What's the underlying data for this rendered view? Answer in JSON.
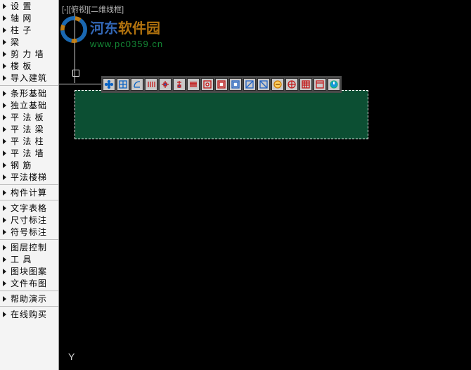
{
  "viewport_label": "[-][俯视][二维线框]",
  "watermark": {
    "title_a": "河东",
    "title_b": "软件园",
    "url": "www.pc0359.cn"
  },
  "sidebar": {
    "groups": [
      [
        {
          "label": "设    置"
        },
        {
          "label": "轴    网"
        },
        {
          "label": "柱    子"
        },
        {
          "label": "梁"
        },
        {
          "label": "剪 力 墙"
        },
        {
          "label": "楼    板"
        },
        {
          "label": "导入建筑"
        }
      ],
      [
        {
          "label": "条形基础"
        },
        {
          "label": "独立基础"
        },
        {
          "label": "平 法 板"
        },
        {
          "label": "平 法 梁"
        },
        {
          "label": "平 法 柱"
        },
        {
          "label": "平 法 墙"
        },
        {
          "label": "钢    筋"
        },
        {
          "label": "平法楼梯"
        }
      ],
      [
        {
          "label": "构件计算"
        }
      ],
      [
        {
          "label": "文字表格"
        },
        {
          "label": "尺寸标注"
        },
        {
          "label": "符号标注"
        }
      ],
      [
        {
          "label": "图层控制"
        },
        {
          "label": "工    具"
        },
        {
          "label": "图块图案"
        },
        {
          "label": "文件布图"
        }
      ],
      [
        {
          "label": "帮助演示"
        }
      ],
      [
        {
          "label": "在线购买"
        }
      ]
    ]
  },
  "toolbar": {
    "buttons": [
      {
        "name": "flower-icon",
        "stroke": "#0963c4",
        "fill": "#0963c4"
      },
      {
        "name": "grid-icon",
        "stroke": "#0963c4",
        "fill": "#e0e0e0"
      },
      {
        "name": "profile-icon",
        "stroke": "#0963c4",
        "fill": "#e0e0e0"
      },
      {
        "name": "columns-icon",
        "stroke": "#c41818",
        "fill": "#e0e0e0"
      },
      {
        "name": "cross-icon",
        "stroke": "#c41818",
        "fill": "#2163c4"
      },
      {
        "name": "marker-icon",
        "stroke": "#c41818",
        "fill": "#2163c4"
      },
      {
        "name": "fence-icon",
        "stroke": "#c41818",
        "fill": "#e0e0e0"
      },
      {
        "name": "target-icon",
        "stroke": "#c41818",
        "fill": "#fff"
      },
      {
        "name": "box-r-icon",
        "stroke": "#c41818",
        "fill": "#fff"
      },
      {
        "name": "box-b-icon",
        "stroke": "#2163c4",
        "fill": "#fff"
      },
      {
        "name": "diag1-icon",
        "stroke": "#2163c4",
        "fill": "#fff"
      },
      {
        "name": "diag2-icon",
        "stroke": "#2163c4",
        "fill": "#fff"
      },
      {
        "name": "circle-icon",
        "stroke": "#cc7a00",
        "fill": "#ffcf5e"
      },
      {
        "name": "circle2-icon",
        "stroke": "#c41818",
        "fill": "#fff"
      },
      {
        "name": "table-icon",
        "stroke": "#c41818",
        "fill": "#e0e0e0"
      },
      {
        "name": "board-icon",
        "stroke": "#c41818",
        "fill": "#fff"
      },
      {
        "name": "power-icon",
        "stroke": "#15b17f",
        "fill": "#1498d8"
      }
    ]
  },
  "ucs": {
    "y_label": "Y"
  }
}
